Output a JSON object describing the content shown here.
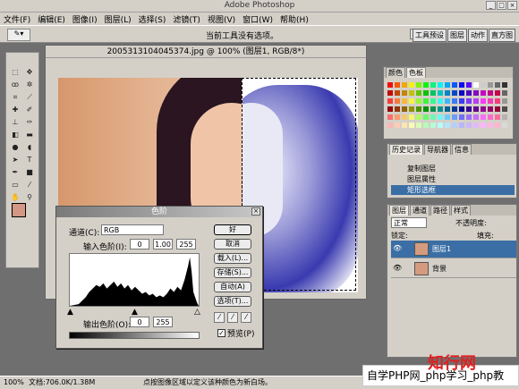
{
  "window": {
    "title": "Adobe Photoshop"
  },
  "menu": [
    "文件(F)",
    "编辑(E)",
    "图像(I)",
    "图层(L)",
    "选择(S)",
    "滤镜(T)",
    "视图(V)",
    "窗口(W)",
    "帮助(H)"
  ],
  "options_bar": {
    "hint": "当前工具没有选项。",
    "tabs": [
      "工具预设",
      "图层",
      "动作",
      "直方图"
    ]
  },
  "document": {
    "title": "2005313104045374.jpg @ 100% (图层1, RGB/8*)"
  },
  "levels": {
    "title": "色阶",
    "channel_label": "通道(C):",
    "channel_value": "RGB",
    "input_label": "输入色阶(I):",
    "input_values": [
      "0",
      "1.00",
      "255"
    ],
    "output_label": "输出色阶(O):",
    "output_values": [
      "0",
      "255"
    ],
    "buttons": [
      "好",
      "取消",
      "载入(L)...",
      "存储(S)...",
      "自动(A)",
      "选项(T)..."
    ],
    "preview_label": "预览(P)",
    "preview_checked": true
  },
  "swatches_panel": {
    "tabs": [
      "颜色",
      "色板"
    ]
  },
  "history_panel": {
    "tabs": [
      "历史记录",
      "导航器",
      "信息"
    ],
    "items": [
      "复制图层",
      "图层属性",
      "矩形选框"
    ],
    "selected_index": 2
  },
  "layers_panel": {
    "tabs": [
      "图层",
      "通道",
      "路径",
      "样式"
    ],
    "blend": "正常",
    "opacity_label": "不透明度:",
    "lock_label": "锁定:",
    "fill_label": "填充:",
    "layers": [
      {
        "name": "图层1",
        "selected": true
      },
      {
        "name": "背景",
        "selected": false
      }
    ]
  },
  "status": {
    "zoom": "100%",
    "doc": "文档:706.0K/1.38M",
    "hint": "点按图像区域以定义该种颜色为新白场。"
  },
  "watermark": {
    "text": "自学PHP网_php学习_php教",
    "logo": "知行网"
  },
  "colors": {
    "foreground": "#d49786",
    "background": "#ffffff",
    "selection": "#3a6ea5"
  }
}
